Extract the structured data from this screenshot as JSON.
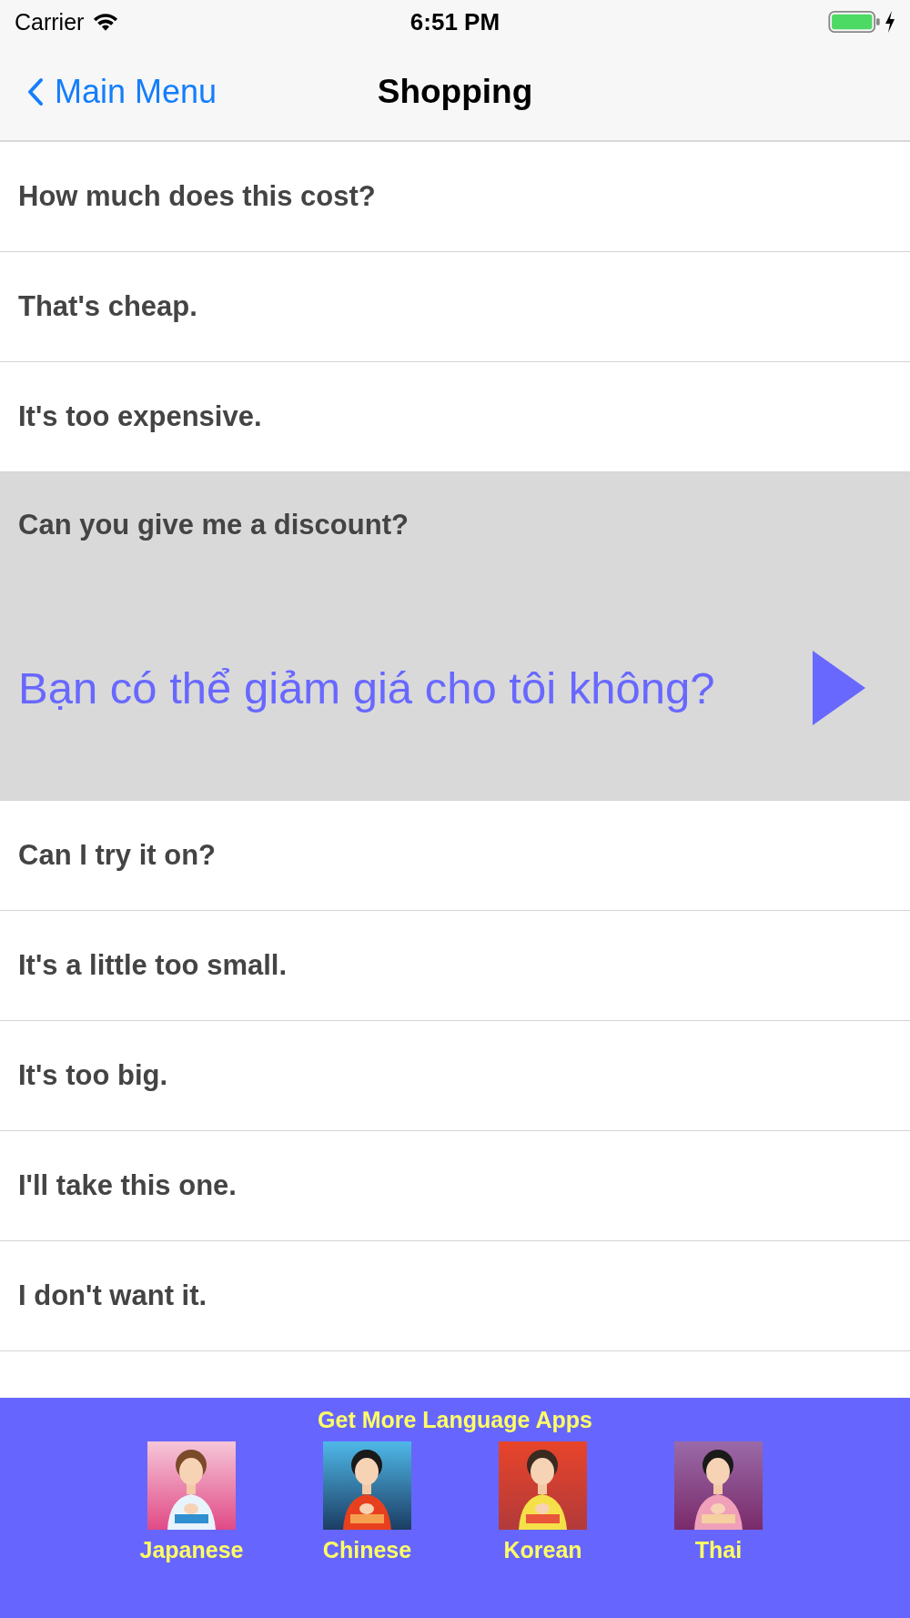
{
  "status_bar": {
    "carrier": "Carrier",
    "time": "6:51 PM"
  },
  "nav_bar": {
    "back_label": "Main Menu",
    "title": "Shopping"
  },
  "phrases": [
    {
      "text": "How much does this cost?",
      "selected": false
    },
    {
      "text": "That's cheap.",
      "selected": false
    },
    {
      "text": "It's too expensive.",
      "selected": false
    },
    {
      "text": "Can you give me a discount?",
      "selected": true,
      "translation": "Bạn có thể giảm giá cho tôi không?"
    },
    {
      "text": "Can I try it on?",
      "selected": false
    },
    {
      "text": "It's a little too small.",
      "selected": false
    },
    {
      "text": "It's too big.",
      "selected": false
    },
    {
      "text": "I'll take this one.",
      "selected": false
    },
    {
      "text": "I don't want it.",
      "selected": false
    }
  ],
  "banner": {
    "title": "Get More Language Apps",
    "apps": [
      {
        "label": "Japanese",
        "kind": "picture"
      },
      {
        "label": "Chinese",
        "kind": "picture"
      },
      {
        "label": "Korean",
        "kind": "picture"
      },
      {
        "label": "Thai",
        "kind": "picture"
      }
    ]
  }
}
